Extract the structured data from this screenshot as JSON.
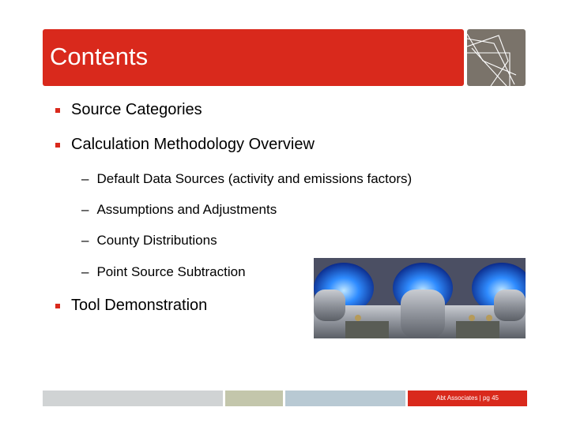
{
  "slide": {
    "title": "Contents",
    "bullets": [
      {
        "label": "Source Categories"
      },
      {
        "label": "Calculation Methodology Overview"
      },
      {
        "label": "Tool Demonstration"
      }
    ],
    "sub_bullets": [
      {
        "dash": "–",
        "label": "Default Data Sources (activity and emissions factors)"
      },
      {
        "dash": "–",
        "label": "Assumptions and Adjustments"
      },
      {
        "dash": "–",
        "label": "County Distributions"
      },
      {
        "dash": "–",
        "label": "Point Source Subtraction"
      }
    ],
    "image": {
      "subject": "gas burner blue flames"
    },
    "footer": {
      "text": "Abt Associates | pg 45"
    },
    "colors": {
      "accent_red": "#d9291c",
      "logo_gray": "#7a736a",
      "footer_gray": "#d0d3d4",
      "footer_olive": "#c3c6ab",
      "footer_blue": "#b8c9d3"
    }
  }
}
